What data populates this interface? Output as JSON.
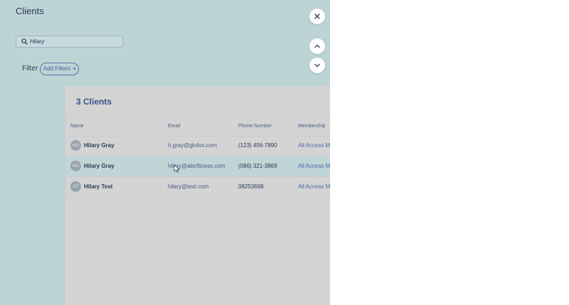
{
  "header": {
    "title": "Clients"
  },
  "search": {
    "value": "Hilary"
  },
  "filter": {
    "label": "Filter",
    "add_label": "Add Filters",
    "add_icon": "+"
  },
  "results": {
    "count_label": "3 Clients",
    "columns": [
      "Name",
      "Email",
      "Phone Number",
      "Membership"
    ],
    "rows": [
      {
        "initials": "HG",
        "name": "Hilary Gray",
        "email": "h.gray@glofox.com",
        "phone": "(123) 456-7890",
        "membership": "All Access Mo"
      },
      {
        "initials": "HG",
        "name": "Hilary Gray",
        "email": "hilary@abcfitness.com",
        "phone": "(086) 321-3869",
        "membership": "All Access Mo"
      },
      {
        "initials": "HT",
        "name": "Hilary Test",
        "email": "hilary@test.com",
        "phone": "08253698",
        "membership": "All Access Mo"
      }
    ]
  },
  "icons": {
    "close": "close-icon",
    "up": "chevron-up-icon",
    "down": "chevron-down-icon",
    "search": "search-icon"
  }
}
